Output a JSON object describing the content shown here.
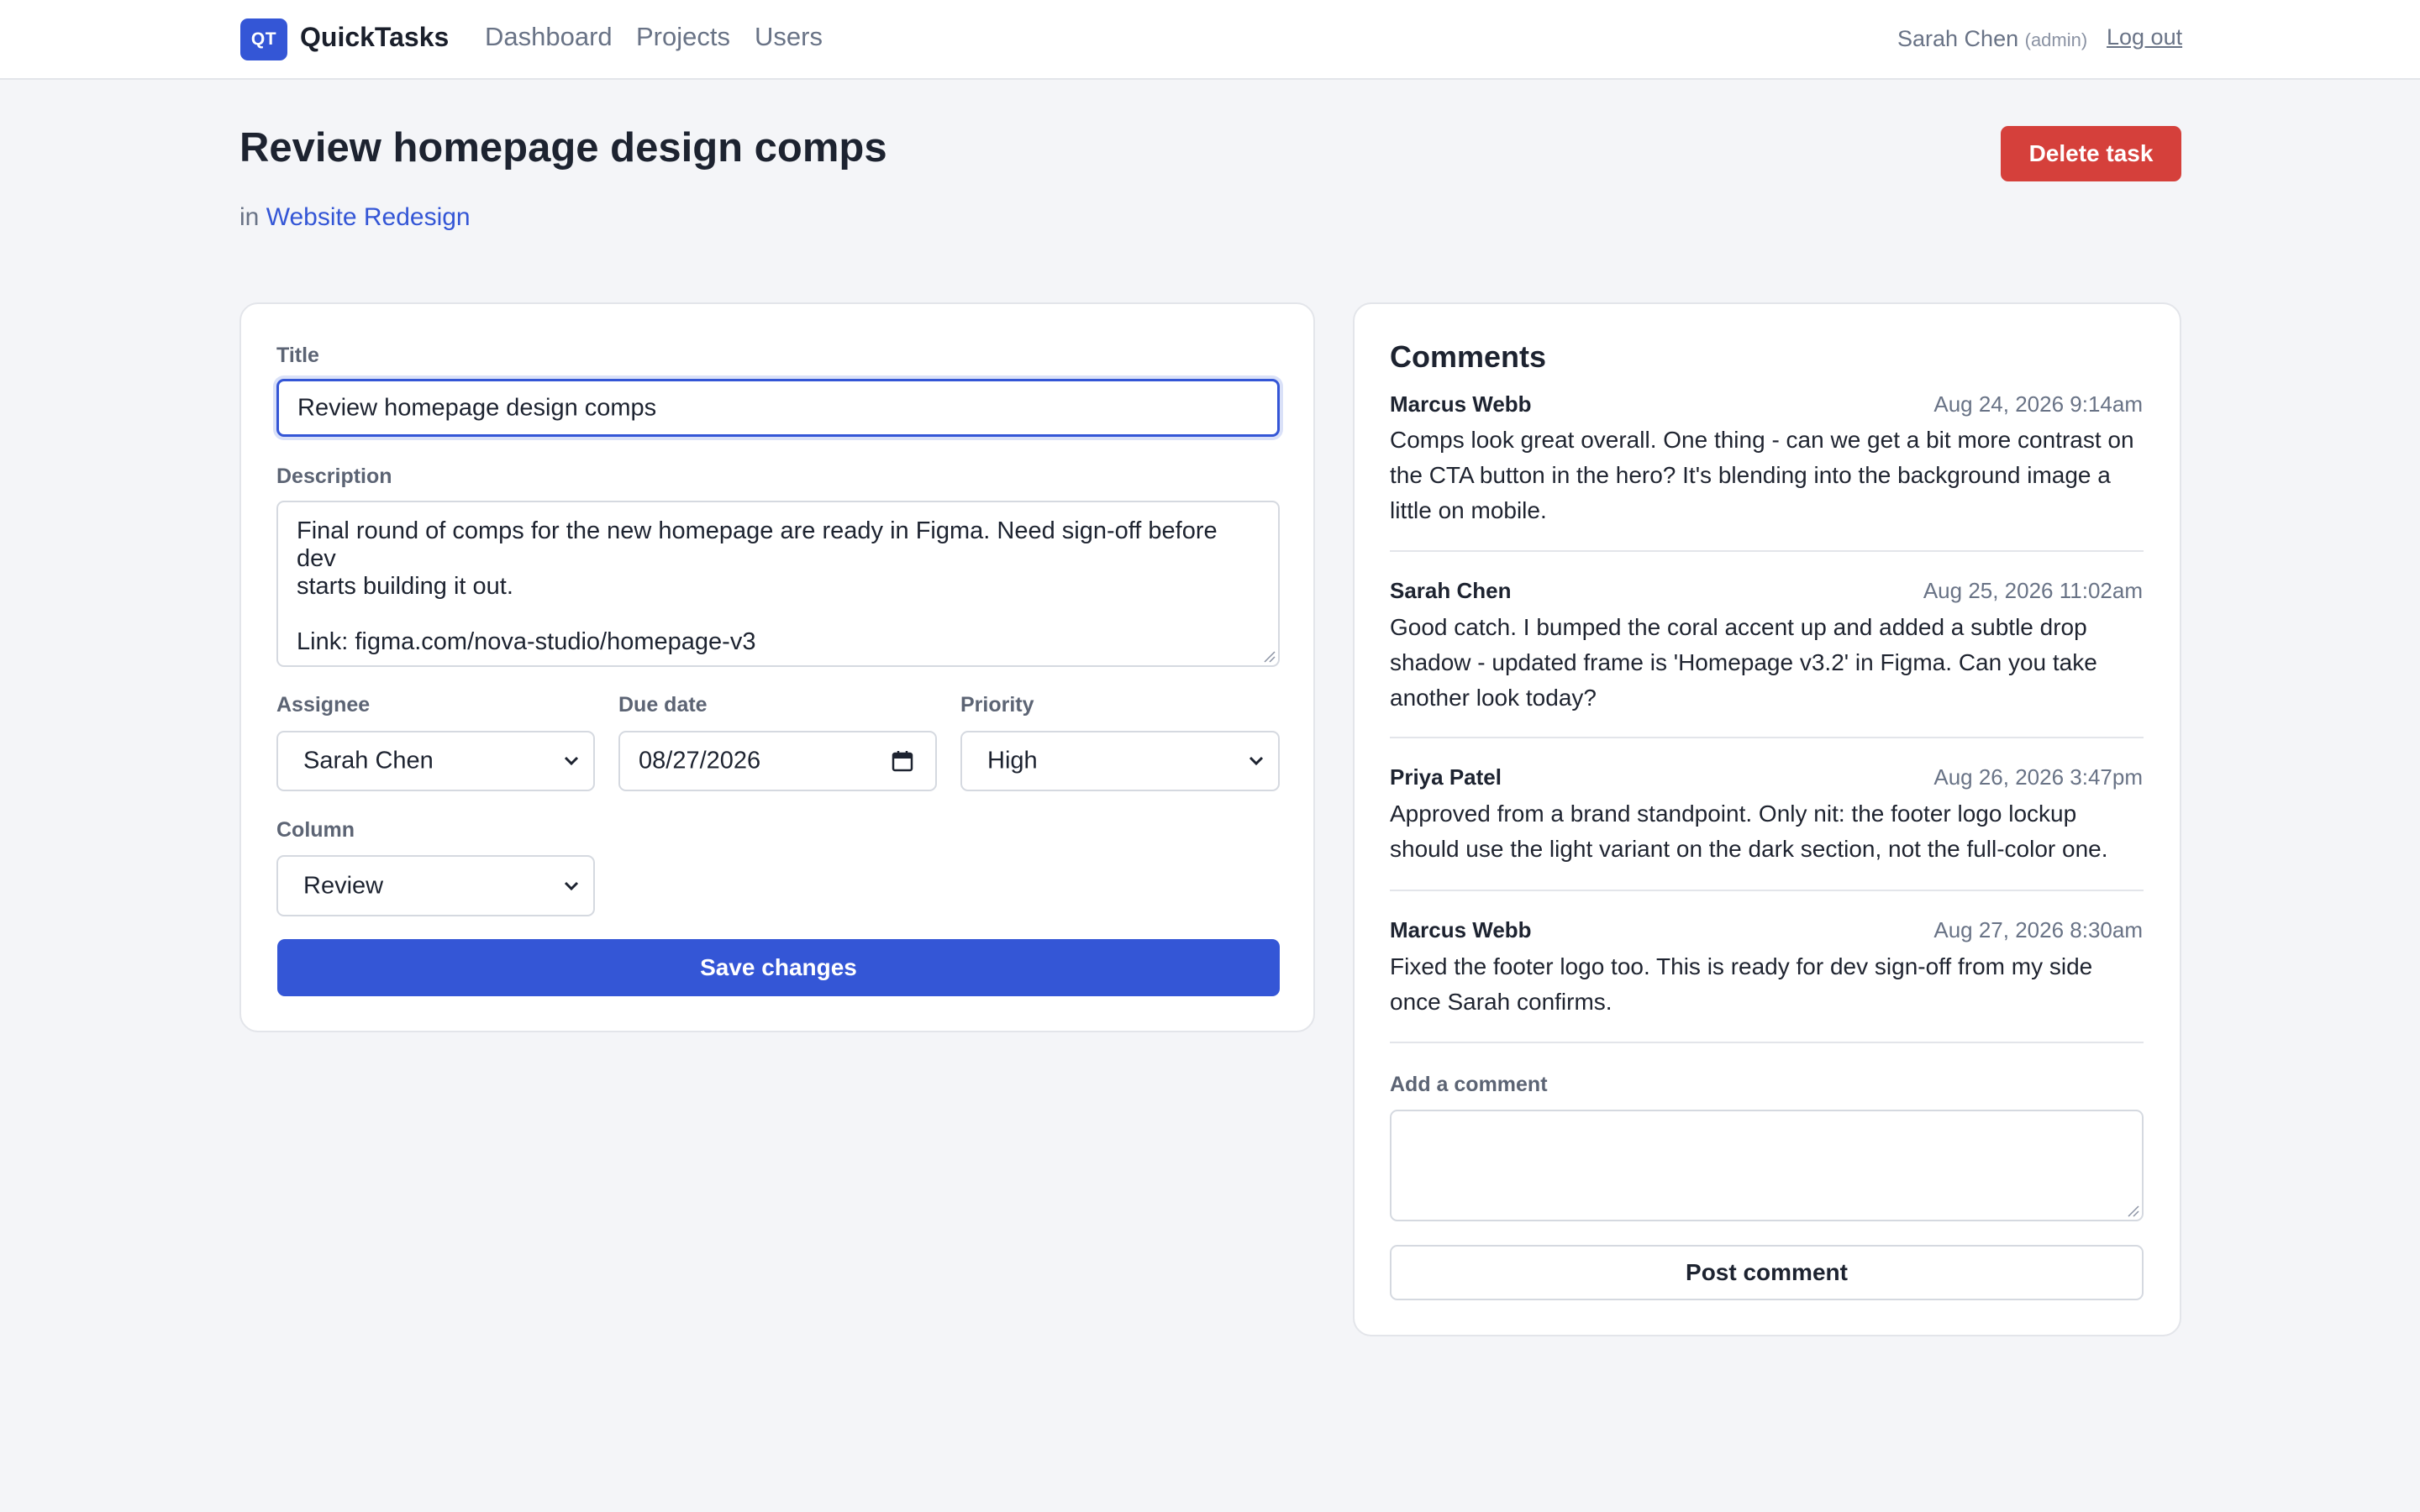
{
  "app": {
    "logo_text": "QT",
    "name": "QuickTasks",
    "nav": [
      "Dashboard",
      "Projects",
      "Users"
    ],
    "user_name": "Sarah Chen",
    "user_role": "(admin)",
    "logout_label": "Log out"
  },
  "page": {
    "title": "Review homepage design comps",
    "in_label": "in",
    "project_name": "Website Redesign",
    "delete_label": "Delete task"
  },
  "form": {
    "title_label": "Title",
    "title_value": "Review homepage design comps",
    "description_label": "Description",
    "description_value": "Final round of comps for the new homepage are ready in Figma. Need sign-off before dev\nstarts building it out.\n\nLink: figma.com/nova-studio/homepage-v3",
    "assignee_label": "Assignee",
    "assignee_value": "Sarah Chen",
    "due_label": "Due date",
    "due_value": "08/27/2026",
    "priority_label": "Priority",
    "priority_value": "High",
    "column_label": "Column",
    "column_value": "Review",
    "save_label": "Save changes"
  },
  "comments": {
    "heading": "Comments",
    "items": [
      {
        "author": "Marcus Webb",
        "time": "Aug 24, 2026 9:14am",
        "body": "Comps look great overall. One thing - can we get a bit more contrast on the CTA button in the hero? It's blending into the background image a little on mobile."
      },
      {
        "author": "Sarah Chen",
        "time": "Aug 25, 2026 11:02am",
        "body": "Good catch. I bumped the coral accent up and added a subtle drop shadow - updated frame is 'Homepage v3.2' in Figma. Can you take another look today?"
      },
      {
        "author": "Priya Patel",
        "time": "Aug 26, 2026 3:47pm",
        "body": "Approved from a brand standpoint. Only nit: the footer logo lockup should use the light variant on the dark section, not the full-color one."
      },
      {
        "author": "Marcus Webb",
        "time": "Aug 27, 2026 8:30am",
        "body": "Fixed the footer logo too. This is ready for dev sign-off from my side once Sarah confirms."
      }
    ],
    "add_label": "Add a comment",
    "add_value": "",
    "post_label": "Post comment"
  },
  "colors": {
    "accent": "#3456d6",
    "danger": "#d5403b",
    "background": "#f4f5f8"
  }
}
